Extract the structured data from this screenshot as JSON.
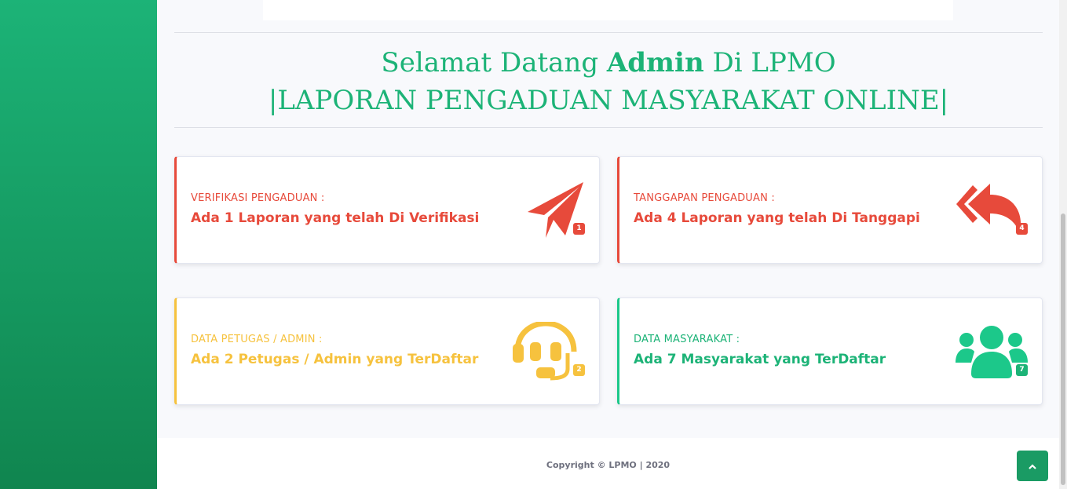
{
  "welcome": {
    "line1_pre": "Selamat Datang ",
    "line1_bold": "Admin",
    "line1_post": " Di LPMO",
    "line2": "|LAPORAN PENGADUAN MASYARAKAT ONLINE|"
  },
  "cards": [
    {
      "label": "VERIFIKASI PENGADUAN :",
      "value": "Ada 1 Laporan yang telah Di Verifikasi",
      "badge": "1",
      "icon": "paper-plane-icon",
      "color": "#e74a3b"
    },
    {
      "label": "TANGGAPAN PENGADUAN :",
      "value": "Ada 4 Laporan yang telah Di Tanggapi",
      "badge": "4",
      "icon": "reply-all-icon",
      "color": "#e74a3b"
    },
    {
      "label": "DATA PETUGAS / ADMIN :",
      "value": "Ada 2 Petugas / Admin yang TerDaftar",
      "badge": "2",
      "icon": "headset-icon",
      "color": "#f6c23e"
    },
    {
      "label": "DATA MASYARAKAT :",
      "value": "Ada 7 Masyarakat yang TerDaftar",
      "badge": "7",
      "icon": "users-icon",
      "color": "#1cb377"
    }
  ],
  "footer": {
    "copyright": "Copyright © LPMO | 2020"
  },
  "scroll_top": {
    "icon": "chevron-up-icon"
  },
  "colors": {
    "primary": "#1cb377",
    "danger": "#e74a3b",
    "warning": "#f6c23e"
  }
}
